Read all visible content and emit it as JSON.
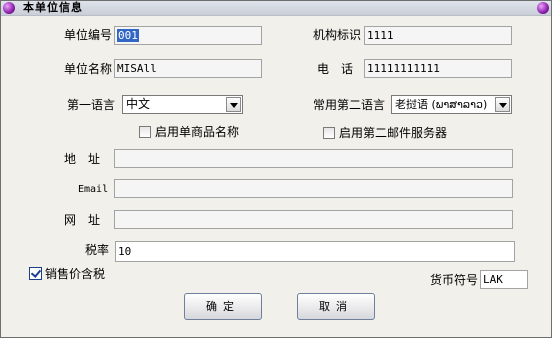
{
  "window": {
    "title": "本单位信息"
  },
  "form": {
    "unit_code": {
      "label": "单位编号",
      "value": "001"
    },
    "org_id": {
      "label": "机构标识",
      "value": "1111"
    },
    "unit_name": {
      "label": "单位名称",
      "value": "MISAll"
    },
    "phone": {
      "label": "电　话",
      "value": "11111111111"
    },
    "first_language": {
      "label": "第一语言",
      "value": "中文"
    },
    "second_language": {
      "label": "常用第二语言",
      "value": "老挝语 (ພາສາລາວ)"
    },
    "enable_product_name": {
      "label": "启用单商品名称",
      "checked": false
    },
    "enable_second_mail": {
      "label": "启用第二邮件服务器",
      "checked": false
    },
    "address": {
      "label": "地　址",
      "value": ""
    },
    "email": {
      "label": "Email",
      "value": ""
    },
    "website": {
      "label": "网　址",
      "value": ""
    },
    "tax_rate": {
      "label": "税率",
      "value": "10"
    },
    "price_includes_tax": {
      "label": "销售价含税",
      "checked": true
    },
    "currency_symbol": {
      "label": "货币符号",
      "value": "LAK"
    }
  },
  "buttons": {
    "ok": "确定",
    "cancel": "取消"
  }
}
